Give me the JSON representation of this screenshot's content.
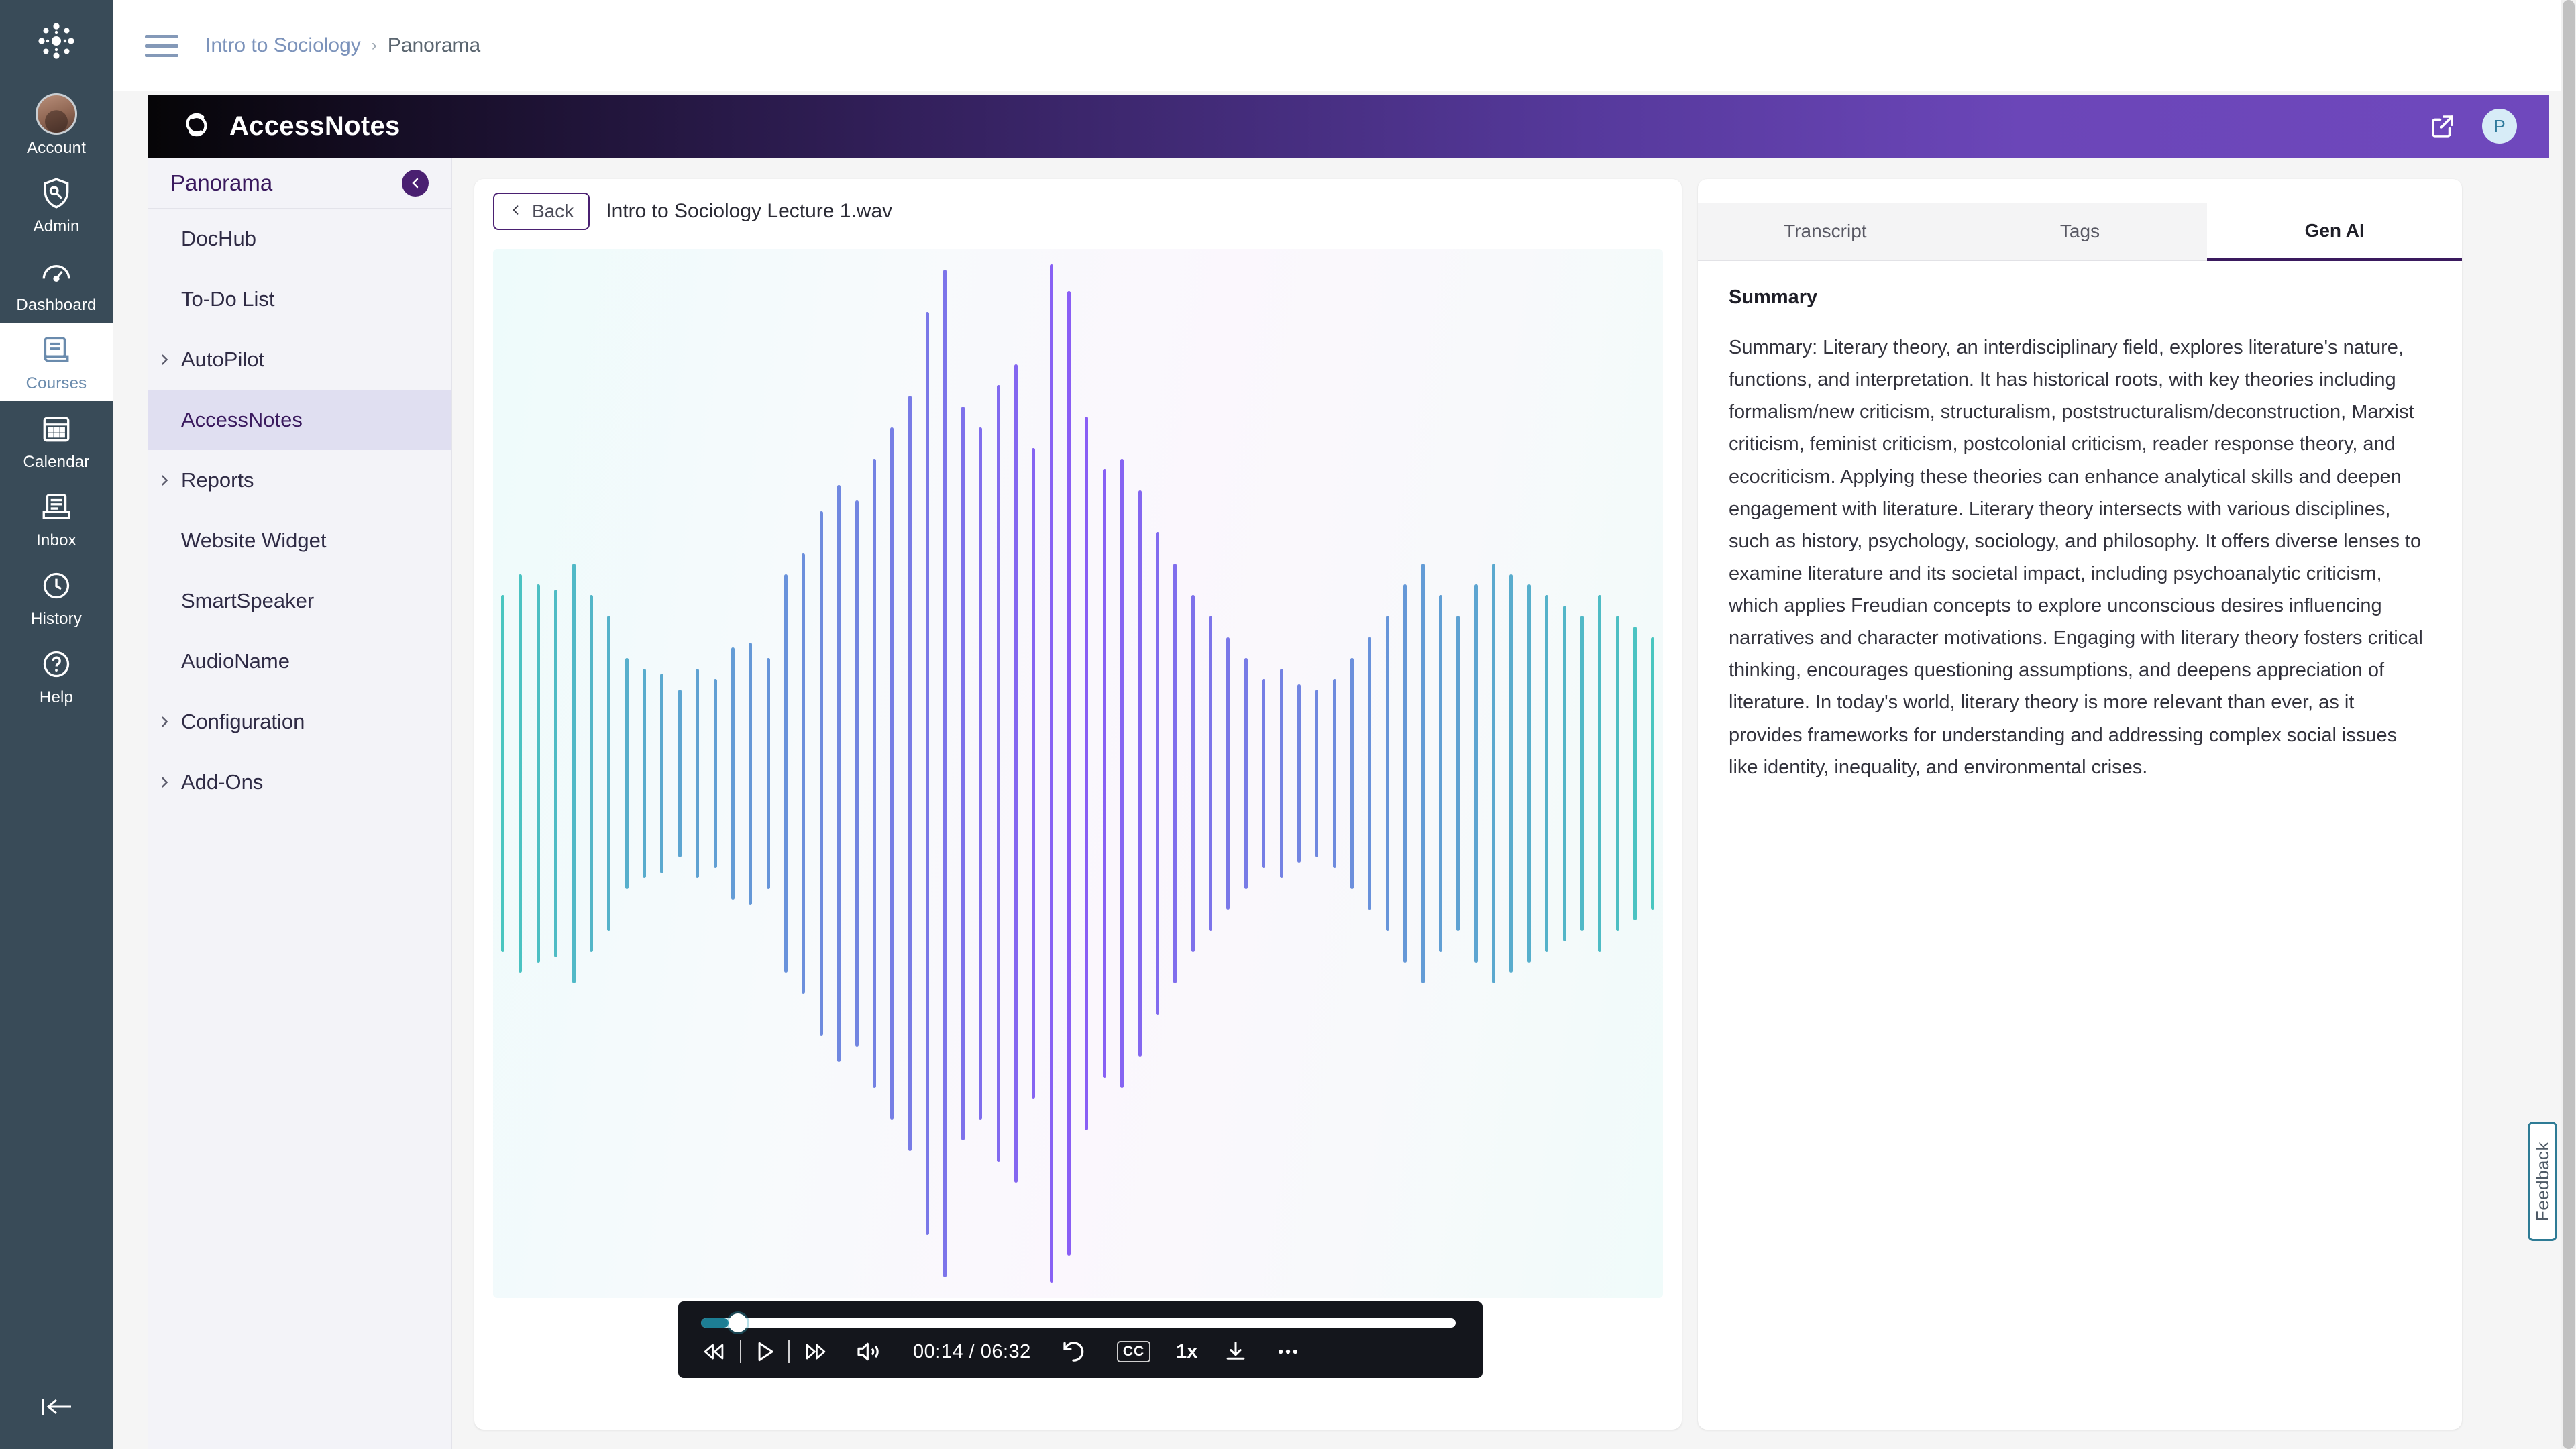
{
  "canvas_nav": {
    "logo_icon": "canvas-logo-icon",
    "items": [
      {
        "label": "Account",
        "icon": "user-avatar-icon",
        "active": false
      },
      {
        "label": "Admin",
        "icon": "shield-wrench-icon",
        "active": false
      },
      {
        "label": "Dashboard",
        "icon": "speedometer-icon",
        "active": false
      },
      {
        "label": "Courses",
        "icon": "book-icon",
        "active": true
      },
      {
        "label": "Calendar",
        "icon": "calendar-icon",
        "active": false
      },
      {
        "label": "Inbox",
        "icon": "inbox-tray-icon",
        "active": false
      },
      {
        "label": "History",
        "icon": "clock-icon",
        "active": false
      },
      {
        "label": "Help",
        "icon": "question-circle-icon",
        "active": false
      }
    ],
    "collapse_icon": "collapse-left-icon"
  },
  "topbar": {
    "menu_icon": "hamburger-menu-icon",
    "breadcrumb": [
      {
        "label": "Intro to Sociology",
        "current": false
      },
      {
        "label": "Panorama",
        "current": true
      }
    ],
    "separator": "›"
  },
  "app_header": {
    "logo_icon": "accessnotes-spiral-icon",
    "brand_name": "AccessNotes",
    "open_external_icon": "external-link-icon",
    "avatar_initial": "P",
    "gradient_start": "#060507",
    "gradient_end": "#6f48bd"
  },
  "panorama": {
    "title": "Panorama",
    "collapse_icon": "arrow-left-circle-icon",
    "items": [
      {
        "label": "DocHub",
        "expandable": false,
        "active": false
      },
      {
        "label": "To-Do List",
        "expandable": false,
        "active": false
      },
      {
        "label": "AutoPilot",
        "expandable": true,
        "active": false
      },
      {
        "label": "AccessNotes",
        "expandable": false,
        "active": true
      },
      {
        "label": "Reports",
        "expandable": true,
        "active": false
      },
      {
        "label": "Website Widget",
        "expandable": false,
        "active": false
      },
      {
        "label": "SmartSpeaker",
        "expandable": false,
        "active": false
      },
      {
        "label": "AudioName",
        "expandable": false,
        "active": false
      },
      {
        "label": "Configuration",
        "expandable": true,
        "active": false
      },
      {
        "label": "Add-Ons",
        "expandable": true,
        "active": false
      }
    ]
  },
  "player": {
    "back_label": "Back",
    "back_icon": "chevron-left-icon",
    "file_name": "Intro to Sociology Lecture 1.wav",
    "time_display": "00:14 / 06:32",
    "current_time": "00:14",
    "duration": "06:32",
    "progress_percent": 3.6,
    "speed_label": "1x",
    "cc_label": "CC",
    "controls": [
      {
        "name": "rewind-button",
        "icon": "rewind-icon"
      },
      {
        "name": "play-button",
        "icon": "play-icon"
      },
      {
        "name": "fast-forward-button",
        "icon": "fast-forward-icon"
      },
      {
        "name": "volume-button",
        "icon": "speaker-volume-icon"
      },
      {
        "name": "replay-button",
        "icon": "replay-loop-icon"
      },
      {
        "name": "captions-button",
        "icon": "closed-captions-icon"
      },
      {
        "name": "speed-button",
        "icon": "playback-speed-icon"
      },
      {
        "name": "download-button",
        "icon": "download-icon"
      },
      {
        "name": "more-options-button",
        "icon": "ellipsis-icon"
      }
    ],
    "waveform": {
      "bar_count": 66,
      "heights_percent": [
        34,
        38,
        36,
        35,
        40,
        34,
        30,
        22,
        20,
        19,
        16,
        20,
        18,
        24,
        25,
        22,
        38,
        42,
        50,
        55,
        52,
        60,
        66,
        72,
        88,
        96,
        70,
        66,
        74,
        78,
        62,
        97,
        92,
        68,
        58,
        60,
        54,
        46,
        40,
        34,
        30,
        26,
        22,
        18,
        20,
        17,
        16,
        18,
        22,
        26,
        30,
        36,
        40,
        34,
        30,
        36,
        40,
        38,
        36,
        34,
        32,
        30,
        34,
        30,
        28,
        26
      ],
      "color_start": "#49c6c0",
      "color_mid": "#8b5cf6",
      "color_end": "#49c6c0"
    }
  },
  "right_panel": {
    "tabs": [
      {
        "label": "Transcript",
        "active": false
      },
      {
        "label": "Tags",
        "active": false
      },
      {
        "label": "Gen AI",
        "active": true
      }
    ],
    "summary_heading": "Summary",
    "summary_text": "Summary: Literary theory, an interdisciplinary field, explores literature's nature, functions, and interpretation. It has historical roots, with key theories including formalism/new criticism, structuralism, poststructuralism/deconstruction, Marxist criticism, feminist criticism, postcolonial criticism, reader response theory, and ecocriticism. Applying these theories can enhance analytical skills and deepen engagement with literature. Literary theory intersects with various disciplines, such as history, psychology, sociology, and philosophy. It offers diverse lenses to examine literature and its societal impact, including psychoanalytic criticism, which applies Freudian concepts to explore unconscious desires influencing narratives and character motivations. Engaging with literary theory fosters critical thinking, encourages questioning assumptions, and deepens appreciation of literature. In today's world, literary theory is more relevant than ever, as it provides frameworks for understanding and addressing complex social issues like identity, inequality, and environmental crises."
  },
  "feedback": {
    "label": "Feedback",
    "accent_color": "#2e7b95"
  }
}
